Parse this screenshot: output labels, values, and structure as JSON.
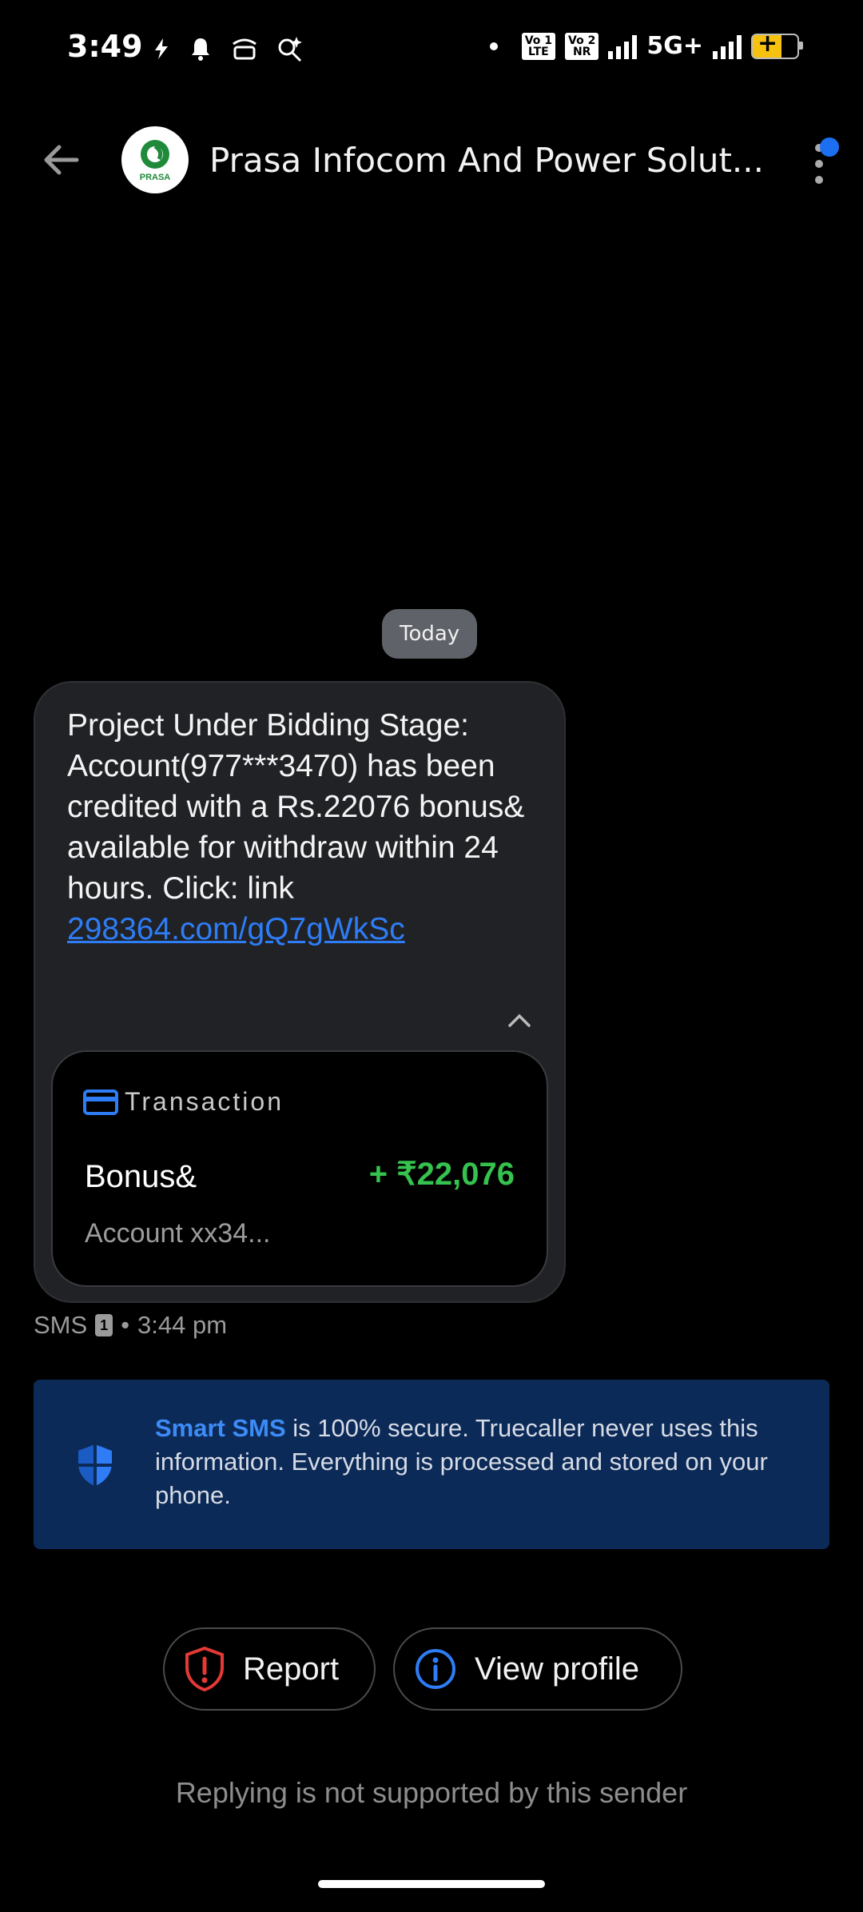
{
  "status_bar": {
    "time": "3:49",
    "lte1_top": "Vo",
    "lte1_bottom": "LTE",
    "lte1_sim": "1",
    "lte2_top": "Vo",
    "lte2_bottom": "NR",
    "lte2_sim": "2",
    "network": "5G+"
  },
  "header": {
    "title": "Prasa Infocom And Power Solut...",
    "avatar_text": "PRASA"
  },
  "date_chip": "Today",
  "message": {
    "text": "Project Under Bidding Stage: Account(977***3470) has been credited with a Rs.22076 bonus& available for withdraw within 24 hours. Click: link",
    "link": "298364.com/gQ7gWkSc"
  },
  "transaction": {
    "heading": "Transaction",
    "name": "Bonus&",
    "amount": "+ ₹22,076",
    "account": "Account xx34..."
  },
  "meta": {
    "type": "SMS",
    "sim": "1",
    "separator": "•",
    "time": "3:44 pm"
  },
  "info_banner": {
    "accent": "Smart SMS",
    "text": " is 100% secure. Truecaller never uses this information. Everything is processed and stored on your phone."
  },
  "actions": {
    "report_label": "Report",
    "profile_label": "View profile"
  },
  "reply_note": "Replying is not supported by this sender",
  "colors": {
    "accent_blue": "#2e7df6",
    "amount_green": "#35c24e",
    "banner_bg": "#0c2a57",
    "report_red": "#e53935"
  }
}
